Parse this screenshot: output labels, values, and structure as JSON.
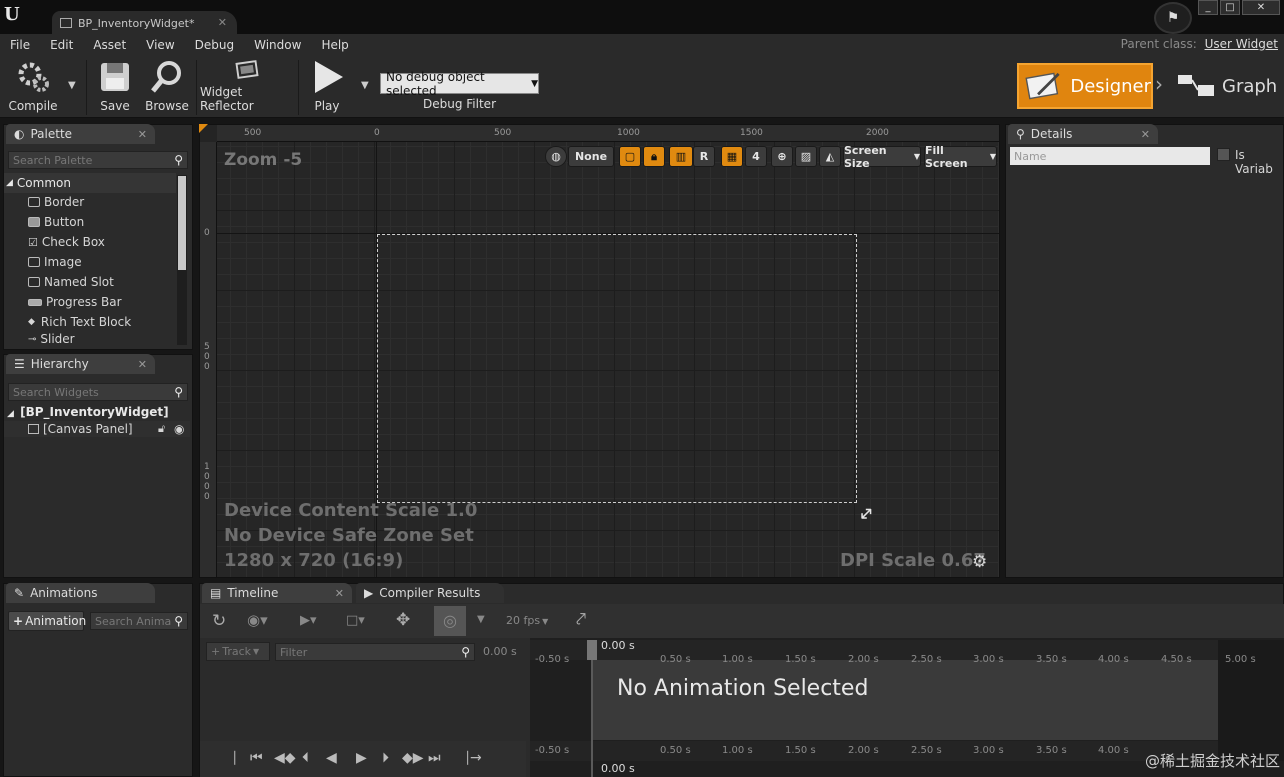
{
  "window": {
    "tab_title": "BP_InventoryWidget*",
    "min": "_",
    "max": "□",
    "close": "✕"
  },
  "menu": [
    "File",
    "Edit",
    "Asset",
    "View",
    "Debug",
    "Window",
    "Help"
  ],
  "parent_class": {
    "label": "Parent class:",
    "value": "User Widget"
  },
  "toolbar": {
    "compile": "Compile",
    "save": "Save",
    "browse": "Browse",
    "widget_reflector": "Widget Reflector",
    "play": "Play",
    "debug_object": "No debug object selected",
    "debug_filter": "Debug Filter",
    "designer": "Designer",
    "graph": "Graph"
  },
  "palette": {
    "tab": "Palette",
    "search_placeholder": "Search Palette",
    "category": "Common",
    "items": [
      "Border",
      "Button",
      "Check Box",
      "Image",
      "Named Slot",
      "Progress Bar",
      "Rich Text Block",
      "Slider"
    ]
  },
  "hierarchy": {
    "tab": "Hierarchy",
    "search_placeholder": "Search Widgets",
    "root": "[BP_InventoryWidget]",
    "child": "[Canvas Panel]"
  },
  "designer": {
    "zoom": "Zoom -5",
    "ruler_top": [
      "500",
      "0",
      "500",
      "1000",
      "1500",
      "2000"
    ],
    "ruler_left_0": "0",
    "ruler_left_500": "5\n0\n0",
    "ruler_left_1000": "1\n0\n0\n0",
    "device_content_scale": "Device Content Scale 1.0",
    "safe_zone": "No Device Safe Zone Set",
    "resolution": "1280 x 720 (16:9)",
    "dpi_scale": "DPI Scale 0.67",
    "toolbar": {
      "localization": "None",
      "r_btn": "R",
      "grid_snap": "4",
      "screen_size": "Screen Size",
      "fill_screen": "Fill Screen"
    }
  },
  "details": {
    "tab": "Details",
    "name_placeholder": "Name",
    "is_variable": "Is Variab"
  },
  "animations": {
    "tab": "Animations",
    "add_button": "Animation",
    "search_placeholder": "Search Anima"
  },
  "timeline": {
    "tab": "Timeline",
    "compiler_tab": "Compiler Results",
    "fps": "20 fps",
    "track_btn": "Track",
    "filter_placeholder": "Filter",
    "time_readout": "0.00 s",
    "current_time": "0.00 s",
    "no_animation": "No Animation Selected",
    "ticks": [
      "-0.50 s",
      "0.50 s",
      "1.00 s",
      "1.50 s",
      "2.00 s",
      "2.50 s",
      "3.00 s",
      "3.50 s",
      "4.00 s",
      "4.50 s",
      "5.00 s"
    ]
  },
  "watermark": "@稀土掘金技术社区",
  "colors": {
    "accent_orange": "#e0850f",
    "panel_bg": "#2b2b2b",
    "canvas_bg": "#262626"
  }
}
